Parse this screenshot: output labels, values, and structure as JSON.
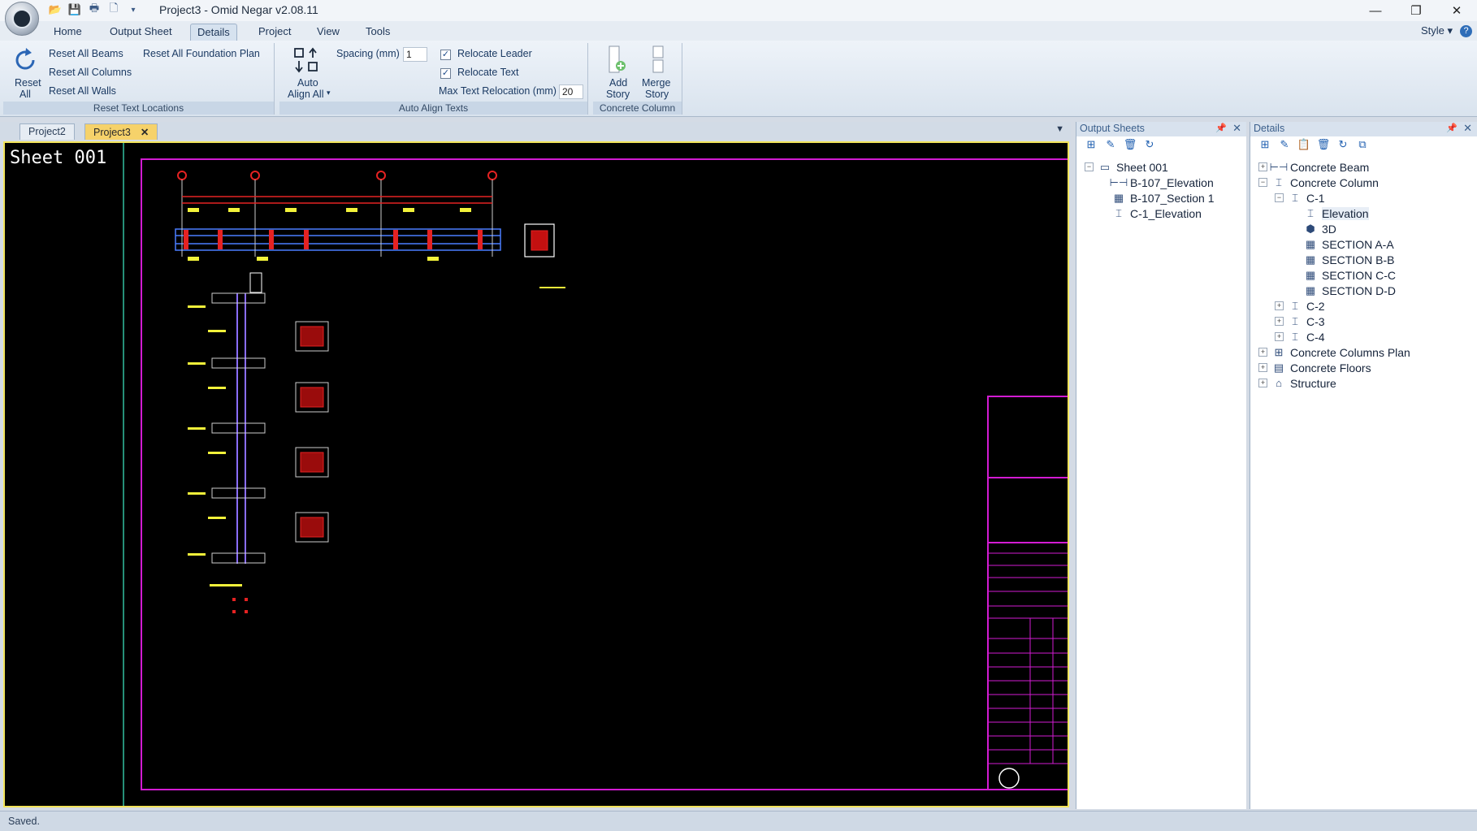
{
  "window": {
    "title": "Project3 - Omid Negar v2.08.11",
    "controls": [
      "—",
      "❐",
      "✕"
    ]
  },
  "quick_access": [
    "open-icon",
    "save-icon",
    "print-icon",
    "new-icon",
    "▾"
  ],
  "menu_tabs": [
    "Home",
    "Output Sheet",
    "Details",
    "Project",
    "View",
    "Tools"
  ],
  "active_tab": "Details",
  "style_menu": "Style",
  "ribbon": {
    "reset_text": {
      "reset_all_label_1": "Reset",
      "reset_all_label_2": "All",
      "reset_all_beams": "Reset All Beams",
      "reset_all_columns": "Reset All Columns",
      "reset_all_walls": "Reset All Walls",
      "reset_all_foundation": "Reset All Foundation Plan",
      "group_label": "Reset Text Locations"
    },
    "auto_align": {
      "auto_align_label_1": "Auto",
      "auto_align_label_2": "Align All",
      "spacing_label": "Spacing (mm)",
      "spacing_value": "1",
      "relocate_leader": "Relocate Leader",
      "relocate_leader_checked": true,
      "relocate_text": "Relocate Text",
      "relocate_text_checked": true,
      "max_text_label": "Max Text Relocation (mm)",
      "max_text_value": "20",
      "group_label": "Auto Align Texts"
    },
    "concrete_column": {
      "add_story_1": "Add",
      "add_story_2": "Story",
      "merge_story_1": "Merge",
      "merge_story_2": "Story",
      "group_label": "Concrete Column"
    }
  },
  "doc_tabs": [
    {
      "label": "Project2",
      "active": false
    },
    {
      "label": "Project3",
      "active": true
    }
  ],
  "canvas": {
    "sheet_label": "Sheet 001"
  },
  "output_sheets": {
    "title": "Output Sheets",
    "items": [
      {
        "label": "Sheet 001",
        "level": 0,
        "expander": "−",
        "icon": "sheet-icon"
      },
      {
        "label": "B-107_Elevation",
        "level": 1,
        "expander": "",
        "icon": "beam-icon"
      },
      {
        "label": "B-107_Section 1",
        "level": 1,
        "expander": "",
        "icon": "section-icon"
      },
      {
        "label": "C-1_Elevation",
        "level": 1,
        "expander": "",
        "icon": "column-icon"
      }
    ]
  },
  "details": {
    "title": "Details",
    "items": [
      {
        "label": "Concrete Beam",
        "level": 0,
        "expander": "+",
        "icon": "beam-icon"
      },
      {
        "label": "Concrete Column",
        "level": 0,
        "expander": "−",
        "icon": "column-icon"
      },
      {
        "label": "C-1",
        "level": 1,
        "expander": "−",
        "icon": "column-icon"
      },
      {
        "label": "Elevation",
        "level": 2,
        "expander": "",
        "icon": "column-icon",
        "selected": true
      },
      {
        "label": "3D",
        "level": 2,
        "expander": "",
        "icon": "cube-icon"
      },
      {
        "label": "SECTION A-A",
        "level": 2,
        "expander": "",
        "icon": "section-icon"
      },
      {
        "label": "SECTION B-B",
        "level": 2,
        "expander": "",
        "icon": "section-icon"
      },
      {
        "label": "SECTION C-C",
        "level": 2,
        "expander": "",
        "icon": "section-icon"
      },
      {
        "label": "SECTION D-D",
        "level": 2,
        "expander": "",
        "icon": "section-icon"
      },
      {
        "label": "C-2",
        "level": 1,
        "expander": "+",
        "icon": "column-icon"
      },
      {
        "label": "C-3",
        "level": 1,
        "expander": "+",
        "icon": "column-icon"
      },
      {
        "label": "C-4",
        "level": 1,
        "expander": "+",
        "icon": "column-icon"
      },
      {
        "label": "Concrete Columns Plan",
        "level": 0,
        "expander": "+",
        "icon": "plan-icon"
      },
      {
        "label": "Concrete Floors",
        "level": 0,
        "expander": "+",
        "icon": "floor-icon"
      },
      {
        "label": "Structure",
        "level": 0,
        "expander": "+",
        "icon": "structure-icon"
      }
    ]
  },
  "status": "Saved."
}
